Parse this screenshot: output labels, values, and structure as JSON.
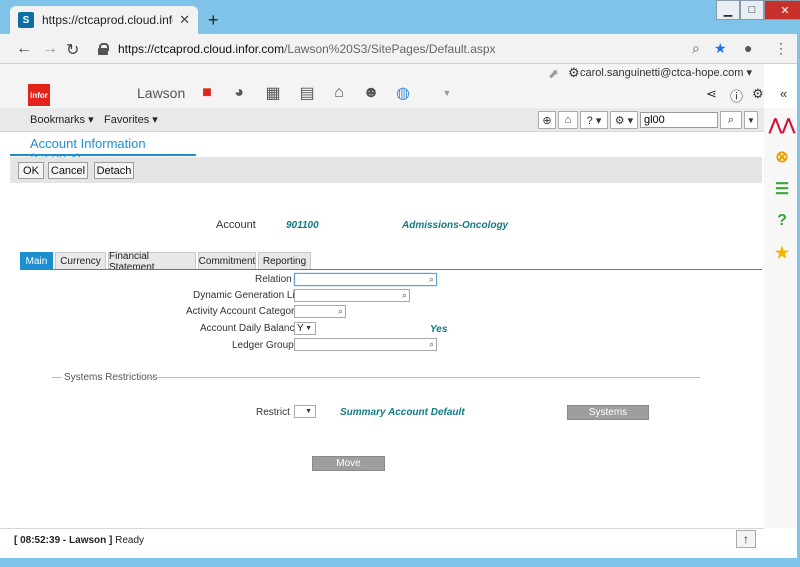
{
  "browser": {
    "tab_title": "https://ctcaprod.cloud.infor.com",
    "tab_icon": "sharepoint-icon",
    "url_host": "https://ctcaprod.cloud.infor.com",
    "url_path": "/Lawson%20S3/SitePages/Default.aspx",
    "accent": "#7fc4e8"
  },
  "app": {
    "logo_text": "infor",
    "name": "Lawson",
    "user": "carol.sanguinetti@ctca-hope.com ▾",
    "brand_color": "#e2231a"
  },
  "toolbar": {
    "bookmarks": "Bookmarks",
    "favorites": "Favorites",
    "search_value": "gl00"
  },
  "form": {
    "title": "Account Information (GL00.4)",
    "buttons": {
      "ok": "OK",
      "cancel": "Cancel",
      "detach": "Detach"
    },
    "account_label": "Account",
    "account_value": "901100",
    "account_desc": "Admissions-Oncology",
    "tabs": [
      "Main",
      "Currency",
      "Financial Statement",
      "Commitment",
      "Reporting"
    ],
    "active_tab": "Main",
    "fields": {
      "relation": "Relation",
      "dynamic_generation": "Dynamic Generation List",
      "activity_category": "Activity Account Category",
      "daily_balance": "Account Daily Balance",
      "daily_balance_value": "Y",
      "daily_balance_desc": "Yes",
      "ledger_group": "Ledger Group"
    },
    "section": "Systems Restrictions",
    "restrict_label": "Restrict",
    "restrict_desc": "Summary Account Default",
    "systems_button": "Systems",
    "move_button": "Move"
  },
  "status": {
    "time": "[ 08:52:39 - Lawson ]",
    "state": "Ready"
  }
}
